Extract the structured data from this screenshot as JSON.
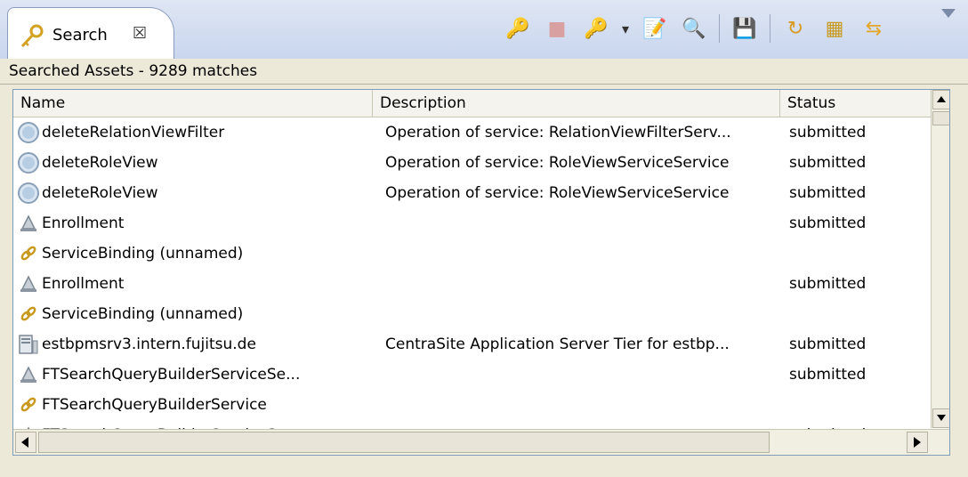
{
  "tab": {
    "title": "Search",
    "close_glyph": "☒",
    "icon": "search-key-icon"
  },
  "toolbar": [
    {
      "name": "search-again-icon",
      "glyph": "🔑"
    },
    {
      "name": "stop-icon",
      "glyph": "■"
    },
    {
      "name": "history-icon",
      "glyph": "🔑"
    },
    {
      "name": "dropdown-icon",
      "glyph": "▾"
    },
    {
      "name": "export-icon",
      "glyph": "📝"
    },
    {
      "name": "search-settings-icon",
      "glyph": "🔍"
    },
    {
      "name": "save-icon",
      "glyph": "💾"
    },
    {
      "name": "refresh-icon",
      "glyph": "↻"
    },
    {
      "name": "layout-icon",
      "glyph": "▦"
    },
    {
      "name": "link-icon",
      "glyph": "⇆"
    }
  ],
  "status_text": "Searched Assets - 9289 matches",
  "columns": [
    "Name",
    "Description",
    "Status"
  ],
  "rows": [
    {
      "icon": "operation",
      "name": "deleteRelationViewFilter",
      "description": "Operation of service: RelationViewFilterServ...",
      "status": "submitted"
    },
    {
      "icon": "operation",
      "name": "deleteRoleView",
      "description": "Operation of service: RoleViewServiceService",
      "status": "submitted"
    },
    {
      "icon": "operation",
      "name": "deleteRoleView",
      "description": "Operation of service: RoleViewServiceService",
      "status": "submitted"
    },
    {
      "icon": "bell",
      "name": "Enrollment",
      "description": "",
      "status": "submitted"
    },
    {
      "icon": "binding",
      "name": "ServiceBinding (unnamed)",
      "description": "",
      "status": ""
    },
    {
      "icon": "bell",
      "name": "Enrollment",
      "description": "",
      "status": "submitted"
    },
    {
      "icon": "binding",
      "name": "ServiceBinding (unnamed)",
      "description": "",
      "status": ""
    },
    {
      "icon": "server",
      "name": "estbpmsrv3.intern.fujitsu.de",
      "description": "CentraSite Application Server Tier for estbp...",
      "status": "submitted"
    },
    {
      "icon": "bell",
      "name": "FTSearchQueryBuilderServiceSe...",
      "description": "",
      "status": "submitted"
    },
    {
      "icon": "binding",
      "name": "FTSearchQueryBuilderService",
      "description": "",
      "status": ""
    },
    {
      "icon": "bell",
      "name": "FTSearchQueryBuilderServiceSe...",
      "description": "",
      "status": "submitted"
    }
  ],
  "colors": {
    "accent": "#7f9db9",
    "header_bg": "#f4f3ee",
    "frame_bg": "#ece9d8"
  }
}
